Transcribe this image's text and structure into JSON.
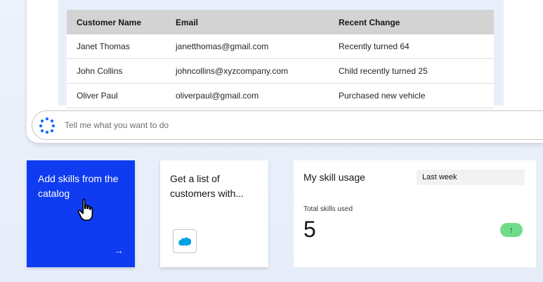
{
  "table": {
    "headers": [
      "Customer Name",
      "Email",
      "Recent Change"
    ],
    "rows": [
      [
        "Janet Thomas",
        "janetthomas@gmail.com",
        "Recently turned 64"
      ],
      [
        "John Collins",
        "johncollins@xyzcompany.com",
        "Child recently turned 25"
      ],
      [
        "Oliver Paul",
        "oliverpaul@gmail.com",
        "Purchased new vehicle"
      ]
    ]
  },
  "chat": {
    "placeholder": "Tell me what you want to do",
    "icon": "spinner-dots-icon"
  },
  "cards": {
    "catalog": {
      "title": "Add skills from the catalog",
      "icon": "arrow-right-icon",
      "color": "#0f3cf0"
    },
    "customers": {
      "title": "Get a list of customers with...",
      "icon": "salesforce-icon",
      "icon_color": "#00a1e0"
    },
    "usage": {
      "title": "My skill usage",
      "period": "Last week",
      "label": "Total skills used",
      "value": "5",
      "trend_icon": "arrow-up-icon",
      "trend_color": "#6fdc8c"
    }
  }
}
